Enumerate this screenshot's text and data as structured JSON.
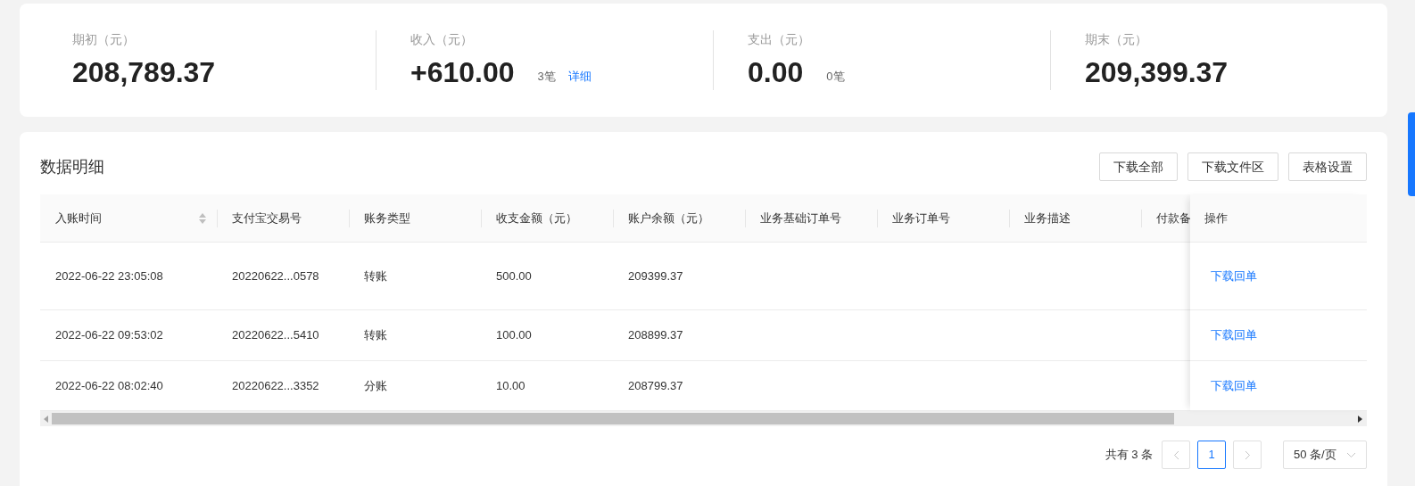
{
  "summary": [
    {
      "label": "期初（元）",
      "value": "208,789.37"
    },
    {
      "label": "收入（元）",
      "value": "+610.00",
      "count": "3笔",
      "link": "详细"
    },
    {
      "label": "支出（元）",
      "value": "0.00",
      "count": "0笔"
    },
    {
      "label": "期末（元）",
      "value": "209,399.37"
    }
  ],
  "details": {
    "title": "数据明细",
    "buttons": [
      "下载全部",
      "下载文件区",
      "表格设置"
    ],
    "table": {
      "columns": [
        {
          "label": "入账时间",
          "sortable": true
        },
        {
          "label": "支付宝交易号",
          "sortable": false
        },
        {
          "label": "账务类型",
          "sortable": false
        },
        {
          "label": "收支金额（元）",
          "sortable": false
        },
        {
          "label": "账户余额（元）",
          "sortable": false
        },
        {
          "label": "业务基础订单号",
          "sortable": false
        },
        {
          "label": "业务订单号",
          "sortable": false
        },
        {
          "label": "业务描述",
          "sortable": false
        },
        {
          "label": "付款备",
          "sortable": false
        }
      ],
      "action_column": "操作",
      "rows": [
        {
          "cells": [
            "2022-06-22 23:05:08",
            "20220622...0578",
            "转账",
            "500.00",
            "209399.37"
          ],
          "action": "下载回单"
        },
        {
          "cells": [
            "2022-06-22 09:53:02",
            "20220622...5410",
            "转账",
            "100.00",
            "208899.37"
          ],
          "action": "下载回单"
        },
        {
          "cells": [
            "2022-06-22 08:02:40",
            "20220622...3352",
            "分账",
            "10.00",
            "208799.37"
          ],
          "action": "下载回单"
        }
      ]
    },
    "pagination": {
      "total": "共有 3 条",
      "pages": [
        {
          "label": "1",
          "selected": true
        }
      ],
      "page_size": "50 条/页"
    }
  }
}
